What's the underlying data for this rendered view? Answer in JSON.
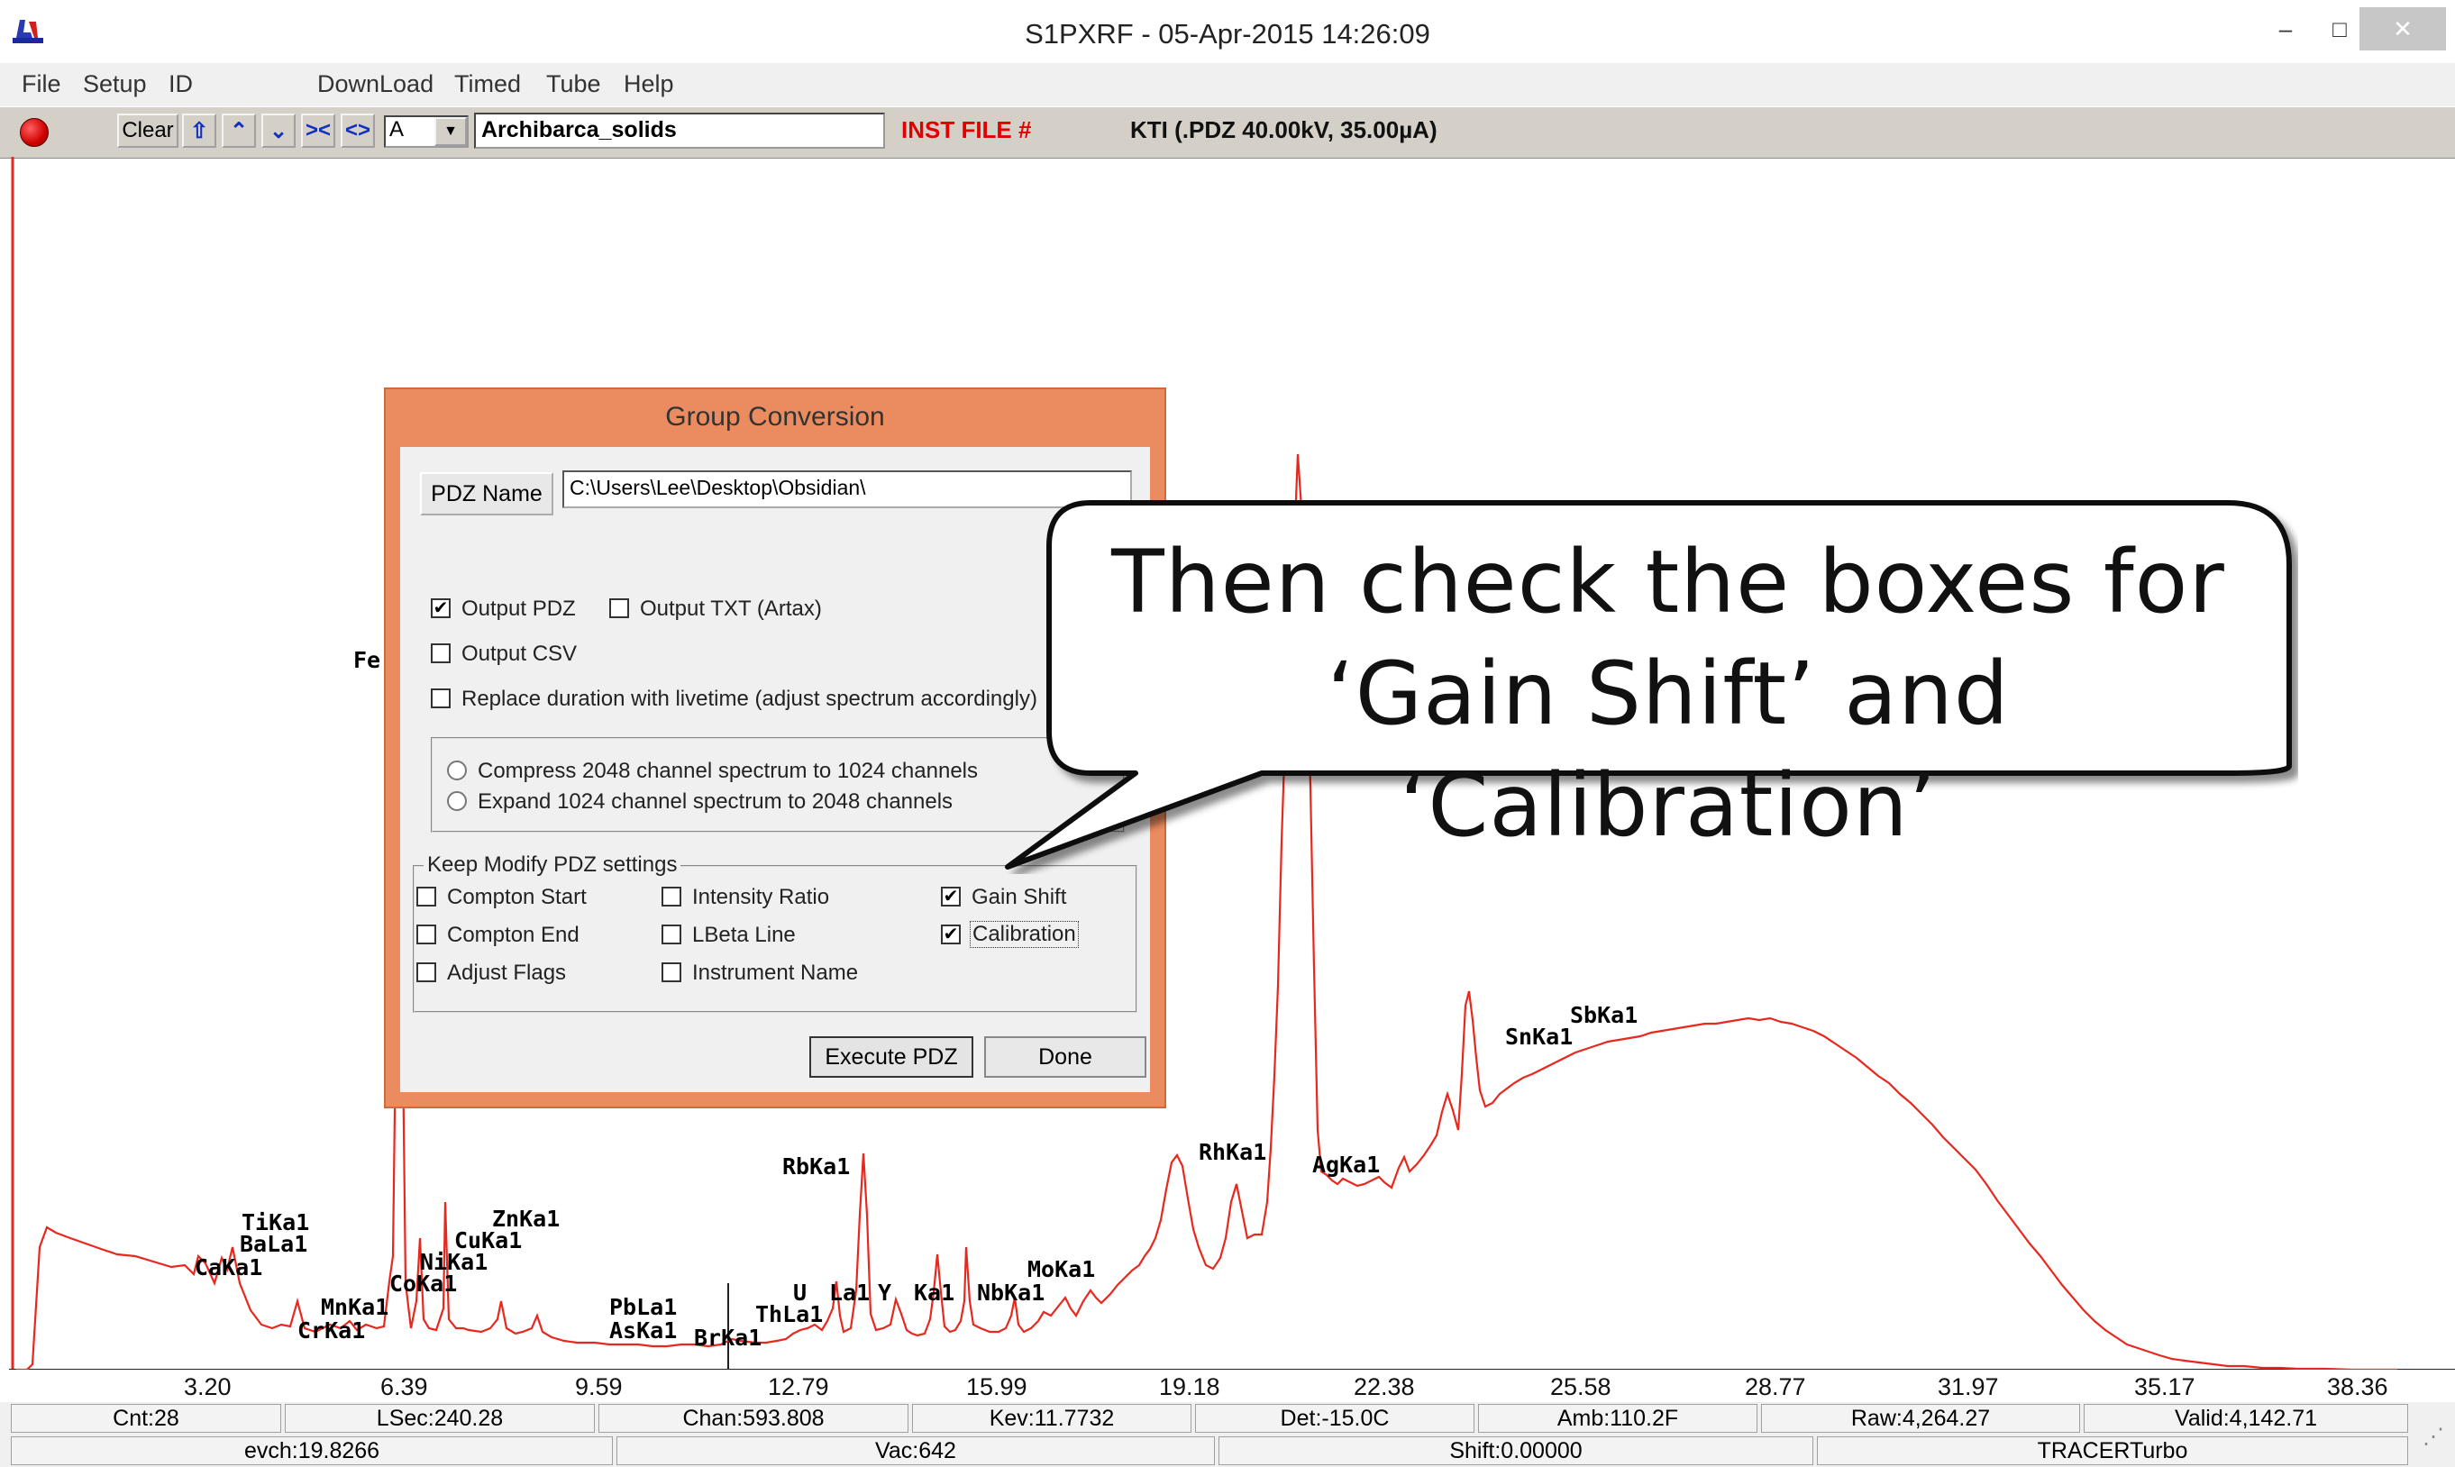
{
  "window": {
    "title": "S1PXRF - 05-Apr-2015 14:26:09",
    "min_glyph": "–",
    "max_glyph": "□",
    "close_glyph": "✕"
  },
  "menu": [
    "File",
    "Setup",
    "ID",
    "DownLoad",
    "Timed",
    "Tube",
    "Help"
  ],
  "toolbar": {
    "clear_label": "Clear",
    "combo_value": "A",
    "sample_name": "Archibarca_solids",
    "inst_file": "INST FILE #",
    "kti": "KTI  (.PDZ 40.00kV, 35.00µA)",
    "nav_glyphs": [
      "⇧",
      "⌃",
      "⌄",
      "><",
      "<>"
    ]
  },
  "plot": {
    "x_ticks": [
      "3.20",
      "6.39",
      "9.59",
      "12.79",
      "15.99",
      "19.18",
      "22.38",
      "25.58",
      "28.77",
      "31.97",
      "35.17",
      "38.36"
    ],
    "peak_labels": [
      "Fe",
      "TiKa1",
      "BaLa1",
      "CaKa1",
      "MnKa1",
      "CrKa1",
      "CoKa1",
      "NiKa1",
      "CuKa1",
      "ZnKa1",
      "PbLa1",
      "AsKa1",
      "BrKa1",
      "RbKa1",
      "U",
      "ThLa1",
      "La1",
      "Y",
      "Ka1",
      "NbKa1",
      "MoKa1",
      "RhKa1",
      "AgKa1",
      "SnKa1",
      "SbKa1"
    ],
    "line_color": "#e8281e"
  },
  "status": {
    "row1": [
      "Cnt:28",
      "LSec:240.28",
      "Chan:593.808",
      "Kev:11.7732",
      "Det:-15.0C",
      "Amb:110.2F",
      "Raw:4,264.27",
      "Valid:4,142.71"
    ],
    "row2": [
      "evch:19.8266",
      "Vac:642",
      "Shift:0.00000",
      "TRACERTurbo"
    ]
  },
  "dialog": {
    "title": "Group Conversion",
    "pdz_name_button": "PDZ Name",
    "path_value": "C:\\Users\\Lee\\Desktop\\Obsidian\\",
    "output_pdz": "Output PDZ",
    "output_txt": "Output TXT (Artax)",
    "output_csv": "Output CSV",
    "replace_duration": "Replace duration with livetime (adjust spectrum accordingly)",
    "compress": "Compress 2048 channel spectrum to 1024 channels",
    "expand": "Expand 1024 channel spectrum to 2048 channels",
    "keep_group": "Keep Modify PDZ settings",
    "compton_start": "Compton Start",
    "compton_end": "Compton End",
    "adjust_flags": "Adjust Flags",
    "intensity_ratio": "Intensity Ratio",
    "lbeta_line": "LBeta Line",
    "instrument_name": "Instrument Name",
    "gain_shift": "Gain Shift",
    "calibration": "Calibration",
    "execute_button": "Execute PDZ",
    "done_button": "Done",
    "checked": {
      "output_pdz": true,
      "output_txt": false,
      "output_csv": false,
      "replace_duration": false,
      "compton_start": false,
      "compton_end": false,
      "adjust_flags": false,
      "intensity_ratio": false,
      "lbeta_line": false,
      "instrument_name": false,
      "gain_shift": true,
      "calibration": true
    }
  },
  "callout": {
    "line1": "Then check the boxes for",
    "line2": "‘Gain Shift’ and ‘Calibration’"
  }
}
